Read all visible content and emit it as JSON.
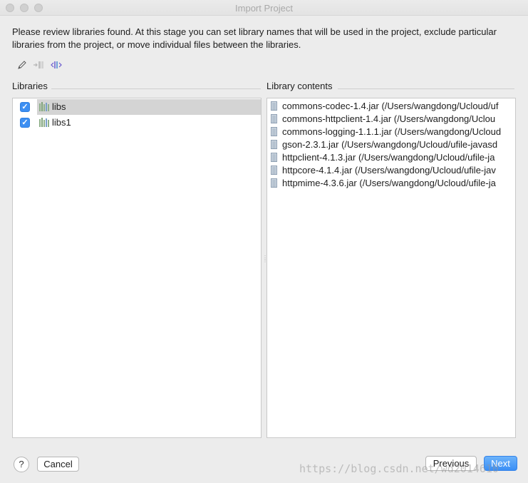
{
  "window": {
    "title": "Import Project"
  },
  "description": "Please review libraries found. At this stage you can set library names that will be used in the project, exclude particular libraries from the project, or move individual files between the libraries.",
  "toolbar": {
    "icons": [
      "pencil-icon",
      "move-to-icon",
      "split-library-icon"
    ]
  },
  "libraries": {
    "label": "Libraries",
    "items": [
      {
        "name": "libs",
        "checked": true,
        "selected": true
      },
      {
        "name": "libs1",
        "checked": true,
        "selected": false
      }
    ]
  },
  "library_contents": {
    "label": "Library contents",
    "items": [
      "commons-codec-1.4.jar (/Users/wangdong/Ucloud/uf",
      "commons-httpclient-1.4.jar (/Users/wangdong/Uclou",
      "commons-logging-1.1.1.jar (/Users/wangdong/Ucloud",
      "gson-2.3.1.jar (/Users/wangdong/Ucloud/ufile-javasd",
      "httpclient-4.1.3.jar (/Users/wangdong/Ucloud/ufile-ja",
      "httpcore-4.1.4.jar (/Users/wangdong/Ucloud/ufile-jav",
      "httpmime-4.3.6.jar (/Users/wangdong/Ucloud/ufile-ja"
    ]
  },
  "buttons": {
    "help": "?",
    "cancel": "Cancel",
    "previous": "Previous",
    "next": "Next"
  },
  "watermark": "https://blog.csdn.net/wd2014610",
  "colors": {
    "accent": "#3d8ff2",
    "selection": "#d4d4d4",
    "library_icon": "#7fa37a"
  }
}
